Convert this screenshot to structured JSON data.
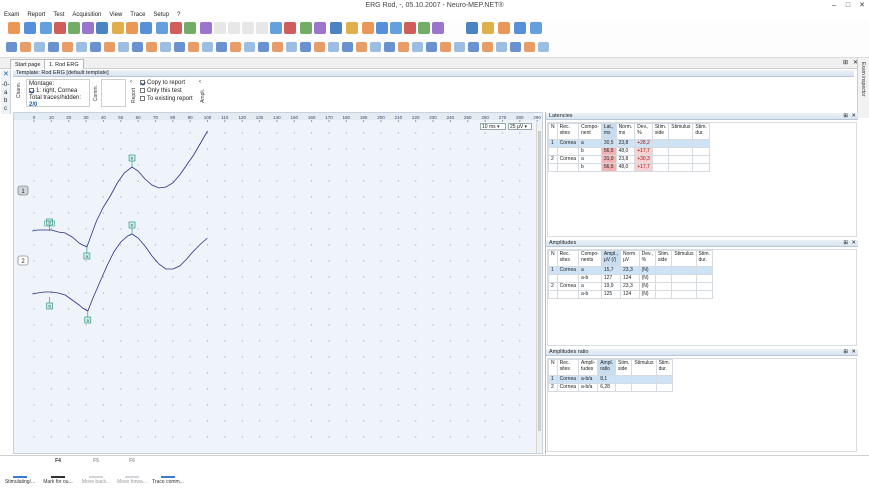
{
  "window": {
    "title": "ERG Rod, -, 05.10.2007 - Neuro-MEP.NET®"
  },
  "menu": [
    "Exam",
    "Report",
    "Test",
    "Acquisition",
    "View",
    "Trace",
    "Setup",
    "?"
  ],
  "tabs": [
    {
      "label": "Start page",
      "active": false
    },
    {
      "label": "1. Rod ERG",
      "active": true
    }
  ],
  "template": {
    "title": "Template: Rod ERG [default template]"
  },
  "channels": {
    "vlabel": "Chann.",
    "montage_label": "Montage:",
    "montage_item": "1: right, Cornea",
    "traces_label": "Total traces/hidden:",
    "traces_value": "2/0",
    "letters": [
      "-0-",
      "a",
      "b",
      "c"
    ]
  },
  "comm": {
    "vlabel": "Comm."
  },
  "report": {
    "vlabel": "Report",
    "copy": "Copy to report",
    "only": "Only this test",
    "existing": "To existing report"
  },
  "ampl": {
    "vlabel": "Ampli."
  },
  "exam_inspector": "Exam inspector",
  "chart": {
    "x_ticks": [
      "0",
      "10",
      "20",
      "30",
      "40",
      "50",
      "60",
      "70",
      "80",
      "90",
      "100",
      "110",
      "120",
      "130",
      "140",
      "150",
      "160",
      "170",
      "180",
      "190",
      "200",
      "210",
      "220",
      "230",
      "240",
      "250",
      "260",
      "270",
      "280",
      "290"
    ],
    "scale_time": "10 ms",
    "scale_amp": "25 µV",
    "trace_labels": [
      "1",
      "2"
    ],
    "marker_labels": {
      "baseline": "S",
      "a": "a",
      "b": "b"
    }
  },
  "latencies": {
    "title": "Latencies",
    "headers": [
      "N",
      "Rec. sites",
      "Compo-nent",
      "Lat., ms",
      "Norm. ms",
      "Dev., %",
      "Stim. side",
      "Stimulus",
      "Stim. dur."
    ],
    "rows": [
      [
        "1",
        "Cornea",
        "a",
        "30,5",
        "23,8",
        "+28,2",
        "",
        "",
        ""
      ],
      [
        "",
        "",
        "b",
        "56,5",
        "48,0",
        "+17,7",
        "",
        "",
        ""
      ],
      [
        "2",
        "Cornea",
        "a",
        "31,0",
        "23,8",
        "+30,3",
        "",
        "",
        ""
      ],
      [
        "",
        "",
        "b",
        "56,5",
        "48,0",
        "+17,7",
        "",
        "",
        ""
      ]
    ]
  },
  "amplitudes": {
    "title": "Amplitudes",
    "headers": [
      "N",
      "Rec. sites",
      "Compo-nents",
      "Ampl., µV (/)",
      "Norm. µV",
      "Dev., %",
      "Stim. side",
      "Stimulus",
      "Stim. dur."
    ],
    "rows": [
      [
        "1",
        "Cornea",
        "a",
        "15,7",
        "23,3",
        "(N)",
        "",
        "",
        ""
      ],
      [
        "",
        "",
        "a-b",
        "127",
        "124",
        "(N)",
        "",
        "",
        ""
      ],
      [
        "2",
        "Cornea",
        "a",
        "19,9",
        "23,3",
        "(N)",
        "",
        "",
        ""
      ],
      [
        "",
        "",
        "a-b",
        "125",
        "124",
        "(N)",
        "",
        "",
        ""
      ]
    ]
  },
  "ratio": {
    "title": "Amplitudes ratio",
    "headers": [
      "N",
      "Rec. sites",
      "Ampli-tudes",
      "Ampl. ratio",
      "Stim. side",
      "Stimulus",
      "Stim. dur."
    ],
    "rows": [
      [
        "1",
        "Cornea",
        "a-b/a",
        "8,1",
        "",
        "",
        ""
      ],
      [
        "2",
        "Cornea",
        "a-b/a",
        "6,28",
        "",
        "",
        ""
      ]
    ]
  },
  "fkeys": [
    {
      "key": "",
      "label": "Stimulating/...",
      "dim": false
    },
    {
      "key": "F4",
      "label": "Mark for ou...",
      "dim": false
    },
    {
      "key": "F5",
      "label": "Move back...",
      "dim": true
    },
    {
      "key": "F6",
      "label": "Move forwa...",
      "dim": true
    },
    {
      "key": "",
      "label": "Trace comm...",
      "dim": false
    }
  ],
  "colors": {
    "accent": "#1c5fa8",
    "trace": "#2b2f86",
    "marker": "#1f8a7a",
    "grid_bg": "#eef4fa"
  }
}
